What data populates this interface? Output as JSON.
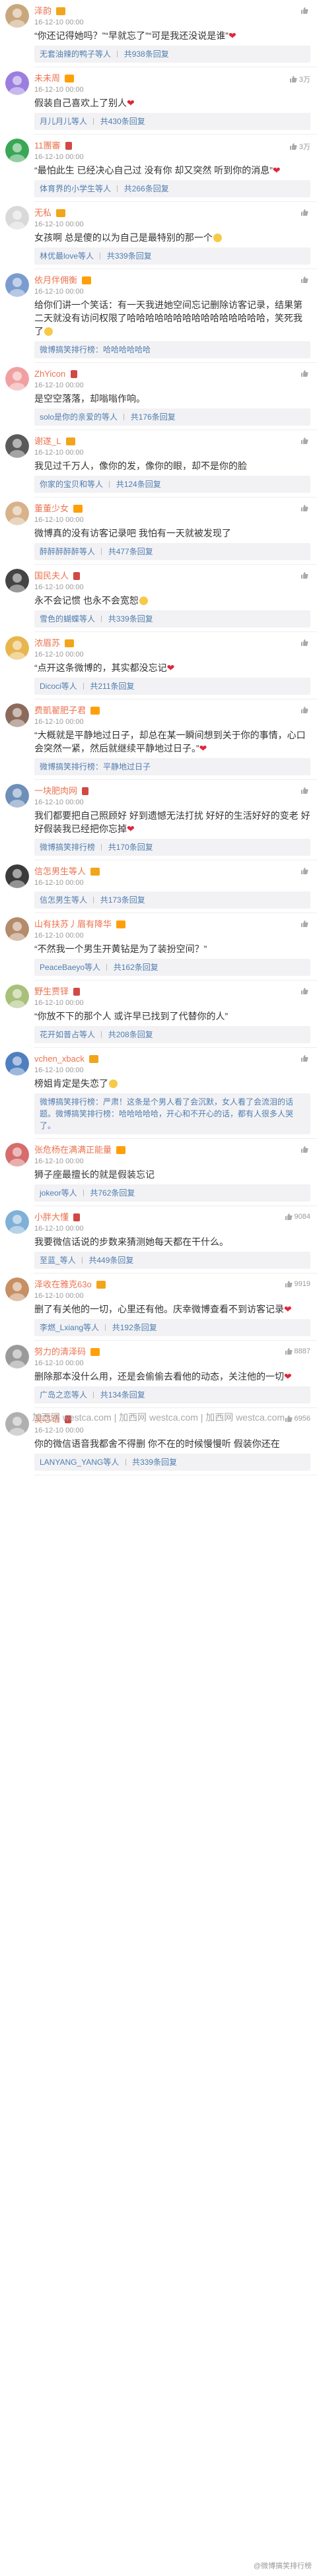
{
  "comments": [
    {
      "user": "泽韵",
      "time": "16-12-10 00:00",
      "text": "“你还记得她吗？”“早就忘了”“可是我还没说是谁”",
      "emoji": "heart",
      "likes": "",
      "reply_author": "无套油辣的鸭子等人",
      "reply_count": "共938条回复"
    },
    {
      "user": "未未周",
      "time": "16-12-10 00:00",
      "text": "假装自己喜欢上了别人",
      "emoji": "heart",
      "likes": "3万",
      "reply_author": "月儿月儿等人",
      "reply_count": "共430条回复"
    },
    {
      "user": "11團審",
      "time": "16-12-10 00:00",
      "text": "“最怕此生 已经决心自己过 没有你  却又突然 听到你的消息”",
      "emoji": "heart",
      "likes": "3万",
      "reply_author": "体育界的小学生等人",
      "reply_count": "共266条回复"
    },
    {
      "user": "无私",
      "time": "16-12-10 00:00",
      "text": "女孩啊 总是傻的以为自己是最特别的那一个",
      "emoji": "smile",
      "likes": "",
      "reply_author": "林优最love等人",
      "reply_count": "共339条回复"
    },
    {
      "user": "依月伴佣衡",
      "time": "16-12-10 00:00",
      "text": "给你们讲一个笑话：有一天我进她空间忘记删除访客记录，结果第二天就没有访问权限了哈哈哈哈哈哈哈哈哈哈哈哈哈哈哈，笑死我了",
      "emoji": "smile",
      "likes": "",
      "reply_author": "微博搞笑排行榜：哈哈哈哈哈哈",
      "reply_count": ""
    },
    {
      "user": "ZhYicon",
      "time": "16-12-10 00:00",
      "text": "是空空落落，却嗡嗡作响。",
      "emoji": "",
      "likes": "",
      "reply_author": "solo是你的亲爱的等人",
      "reply_count": "共176条回复"
    },
    {
      "user": "谢遂_L",
      "time": "16-12-10 00:00",
      "text": "我见过千万人，像你的发，像你的眼，却不是你的脸",
      "emoji": "",
      "likes": "",
      "reply_author": "你家的宝贝和等人",
      "reply_count": "共124条回复"
    },
    {
      "user": "董董少女",
      "time": "16-12-10 00:00",
      "text": "微博真的没有访客记录吧  我怕有一天就被发现了",
      "emoji": "",
      "likes": "",
      "reply_author": "醉醉醉醉醉等人",
      "reply_count": "共477条回复"
    },
    {
      "user": "国民夫人",
      "time": "16-12-10 00:00",
      "text": "永不会记惯 也永不会宽恕",
      "emoji": "smile",
      "likes": "",
      "reply_author": "雪色的蝴蝶等人",
      "reply_count": "共339条回复"
    },
    {
      "user": "浓眉苏",
      "time": "16-12-10 00:00",
      "text": "“点开这条微博的，其实都没忘记",
      "emoji": "heart",
      "likes": "",
      "reply_author": "Dicoci等人",
      "reply_count": "共211条回复"
    },
    {
      "user": "费凱翟肥子君",
      "time": "16-12-10 00:00",
      "text": "“大概就是平静地过日子，却总在某一瞬间想到关于你的事情，心口会突然一紧，然后就继续平静地过日子。”",
      "emoji": "heart",
      "likes": "",
      "reply_author": "微博搞笑排行榜：平静地过日子",
      "reply_count": ""
    },
    {
      "user": "一块肥肉网",
      "time": "16-12-10 00:00",
      "text": "我们都要把自己照顾好 好到遗憾无法打扰 好好的生活好好的变老 好好假装我已经把你忘掉",
      "emoji": "heart",
      "likes": "",
      "reply_author": "微博搞笑排行榜",
      "reply_count": "共170条回复"
    },
    {
      "user": "信怎男生等人",
      "time": "16-12-10 00:00",
      "text": "",
      "emoji": "",
      "likes": "",
      "reply_author": "信怎男生等人",
      "reply_count": "共173条回复"
    },
    {
      "user": "山有扶苏丿眉有降华",
      "time": "16-12-10 00:00",
      "text": "“不然我一个男生开黄钻是为了装扮空间？”",
      "emoji": "",
      "likes": "",
      "reply_author": "PeaceBaeyo等人",
      "reply_count": "共162条回复"
    },
    {
      "user": "野生贾铎",
      "time": "16-12-10 00:00",
      "text": "“你放不下的那个人 或许早已找到了代替你的人”",
      "emoji": "",
      "likes": "",
      "reply_author": "花开如普占等人",
      "reply_count": "共208条回复"
    },
    {
      "user": "vchen_xback",
      "time": "16-12-10 00:00",
      "text": "榜姐肯定是失恋了",
      "emoji": "smile",
      "likes": "",
      "reply_author": "微博搞笑排行榜：严肃！这条是个男人看了会沉默，女人看了会流泪的话题。微博搞笑排行榜：哈哈哈哈哈，开心和不开心的话，都有人很多人哭了。",
      "reply_count": ""
    },
    {
      "user": "张危杨在满满正能量",
      "time": "16-12-10 00:00",
      "text": "狮子座最擅长的就是假装忘记",
      "emoji": "",
      "likes": "",
      "reply_author": "jokeor等人",
      "reply_count": "共762条回复"
    },
    {
      "user": "小胖大懂",
      "time": "16-12-10 00:00",
      "text": "我要微信话说的步数来猜测她每天都在干什么。",
      "emoji": "",
      "likes": "9084",
      "reply_author": "至蓝_等人",
      "reply_count": "共449条回复"
    },
    {
      "user": "泽收在雅克63o",
      "time": "16-12-10 00:00",
      "text": "删了有关他的一切，心里还有他。庆幸微博查看不到访客记录",
      "emoji": "heart",
      "likes": "9919",
      "reply_author": "李燃_Lxiang等人",
      "reply_count": "共192条回复"
    },
    {
      "user": "努力的清泽码",
      "time": "16-12-10 00:00",
      "text": "删除那本没什么用，还是会偷偷去看他的动态，关注他的一切",
      "emoji": "heart",
      "likes": "8887",
      "reply_author": "广岛之恋等人",
      "reply_count": "共134条回复"
    },
    {
      "user": "吴芯语",
      "time": "16-12-10 00:00",
      "text": "你的微信语音我都舍不得删 你不在的时候慢慢听 假装你还在",
      "emoji": "",
      "likes": "6956",
      "reply_author": "LANYANG_YANG等人",
      "reply_count": "共339条回复"
    }
  ],
  "watermark": "加西网 westca.com | 加西网 westca.com | 加西网 westca.com",
  "bottom_mark": "@微博搞笑排行榜"
}
